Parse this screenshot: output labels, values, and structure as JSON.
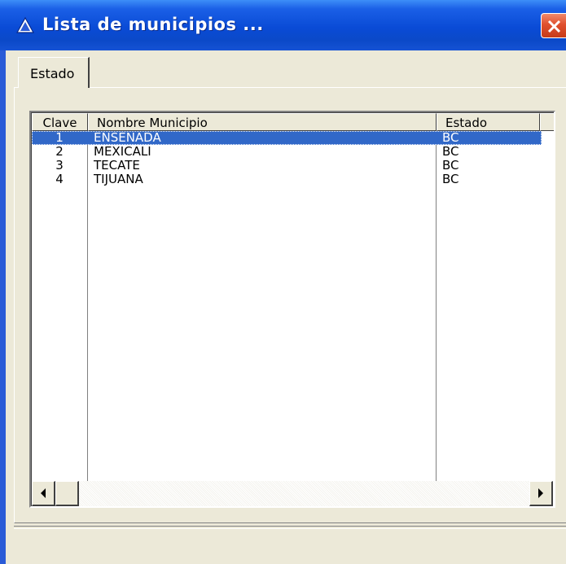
{
  "window": {
    "title": "Lista de municipios ...",
    "colors": {
      "titlebar": "#0a4bd6",
      "close": "#e0502e",
      "selection": "#3168c8",
      "face": "#ece9d8"
    }
  },
  "tabs": [
    {
      "label": "Estado",
      "selected": true
    }
  ],
  "grid": {
    "columns": [
      {
        "key": "clave",
        "label": "Clave"
      },
      {
        "key": "nombre",
        "label": "Nombre Municipio"
      },
      {
        "key": "estado",
        "label": "Estado"
      }
    ],
    "rows": [
      {
        "clave": "1",
        "nombre": "ENSENADA",
        "estado": "BC",
        "selected": true
      },
      {
        "clave": "2",
        "nombre": "MEXICALI",
        "estado": "BC",
        "selected": false
      },
      {
        "clave": "3",
        "nombre": "TECATE",
        "estado": "BC",
        "selected": false
      },
      {
        "clave": "4",
        "nombre": "TIJUANA",
        "estado": "BC",
        "selected": false
      }
    ]
  },
  "icons": {
    "title": "triangle-icon",
    "close": "close-icon",
    "scroll_left": "arrow-left-icon",
    "scroll_right": "arrow-right-icon"
  }
}
